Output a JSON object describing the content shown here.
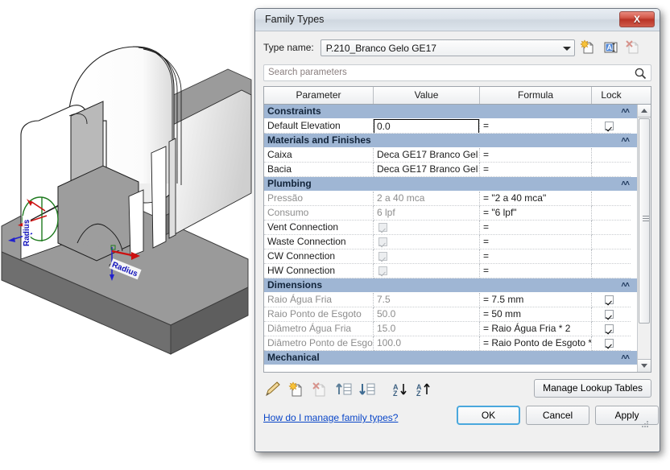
{
  "window": {
    "title": "Family Types",
    "close_label": "X"
  },
  "type_row": {
    "label": "Type name:",
    "value": "P.210_Branco Gelo GE17",
    "icons": [
      {
        "name": "new-type-icon",
        "title": "New Type"
      },
      {
        "name": "rename-type-icon",
        "title": "Rename"
      },
      {
        "name": "delete-type-icon",
        "title": "Delete Type"
      }
    ]
  },
  "search": {
    "placeholder": "Search parameters",
    "icon": "search-icon"
  },
  "table": {
    "columns": [
      "Parameter",
      "Value",
      "Formula",
      "Lock"
    ],
    "groups": [
      {
        "name": "Constraints",
        "rows": [
          {
            "parameter": "Default Elevation",
            "value": "0.0",
            "formula": "=",
            "lock": "checked",
            "editing": true,
            "dim": false
          }
        ]
      },
      {
        "name": "Materials and Finishes",
        "rows": [
          {
            "parameter": "Caixa",
            "value": "Deca GE17 Branco Gel",
            "formula": "=",
            "lock": "",
            "editing": false,
            "dim": false
          },
          {
            "parameter": "Bacia",
            "value": "Deca GE17 Branco Gel",
            "formula": "=",
            "lock": "",
            "editing": false,
            "dim": false
          }
        ]
      },
      {
        "name": "Plumbing",
        "rows": [
          {
            "parameter": "Pressão",
            "value": "2 a 40 mca",
            "formula": "= \"2 a 40 mca\"",
            "lock": "",
            "editing": false,
            "dim": true
          },
          {
            "parameter": "Consumo",
            "value": "6 lpf",
            "formula": "= \"6 lpf\"",
            "lock": "",
            "editing": false,
            "dim": true
          },
          {
            "parameter": "Vent Connection",
            "value": "",
            "formula": "=",
            "lock": "",
            "editing": false,
            "dim": false,
            "value_checkbox": "checked-gray"
          },
          {
            "parameter": "Waste Connection",
            "value": "",
            "formula": "=",
            "lock": "",
            "editing": false,
            "dim": false,
            "value_checkbox": "checked-gray"
          },
          {
            "parameter": "CW Connection",
            "value": "",
            "formula": "=",
            "lock": "",
            "editing": false,
            "dim": false,
            "value_checkbox": "checked-gray"
          },
          {
            "parameter": "HW Connection",
            "value": "",
            "formula": "=",
            "lock": "",
            "editing": false,
            "dim": false,
            "value_checkbox": "checked-gray"
          }
        ]
      },
      {
        "name": "Dimensions",
        "rows": [
          {
            "parameter": "Raio Água Fria",
            "value": "7.5",
            "formula": "= 7.5 mm",
            "lock": "checked",
            "editing": false,
            "dim": true
          },
          {
            "parameter": "Raio Ponto de Esgoto",
            "value": "50.0",
            "formula": "= 50 mm",
            "lock": "checked",
            "editing": false,
            "dim": true
          },
          {
            "parameter": "Diâmetro Água Fria",
            "value": "15.0",
            "formula": "= Raio Água Fria * 2",
            "lock": "checked",
            "editing": false,
            "dim": true
          },
          {
            "parameter": "Diâmetro Ponto de Esgo",
            "value": "100.0",
            "formula": "= Raio Ponto de Esgoto *",
            "lock": "checked",
            "editing": false,
            "dim": true
          }
        ]
      },
      {
        "name": "Mechanical",
        "rows": []
      }
    ]
  },
  "toolbar": {
    "icons": [
      {
        "name": "edit-parameter-icon",
        "title": "Modify"
      },
      {
        "name": "new-parameter-icon",
        "title": "New Parameter"
      },
      {
        "name": "delete-parameter-icon",
        "title": "Remove Parameter"
      },
      {
        "name": "move-up-icon",
        "title": "Move Up"
      },
      {
        "name": "move-down-icon",
        "title": "Move Down"
      },
      {
        "name": "sort-ascending-icon",
        "title": "Sort Ascending"
      },
      {
        "name": "sort-descending-icon",
        "title": "Sort Descending"
      }
    ],
    "manage_lookup_tables": "Manage Lookup Tables"
  },
  "footer": {
    "help_link": "How do I manage family types?",
    "ok": "OK",
    "cancel": "Cancel",
    "apply": "Apply"
  },
  "viewport": {
    "annotations": [
      "Radius",
      "Radius"
    ],
    "background": "#ffffff"
  },
  "colors": {
    "group_header": "#9fb6d4",
    "dialog_bg": "#f0f0f0",
    "close_red": "#b93427",
    "link_blue": "#0a46c8",
    "focus_blue": "#4aa8dd"
  }
}
